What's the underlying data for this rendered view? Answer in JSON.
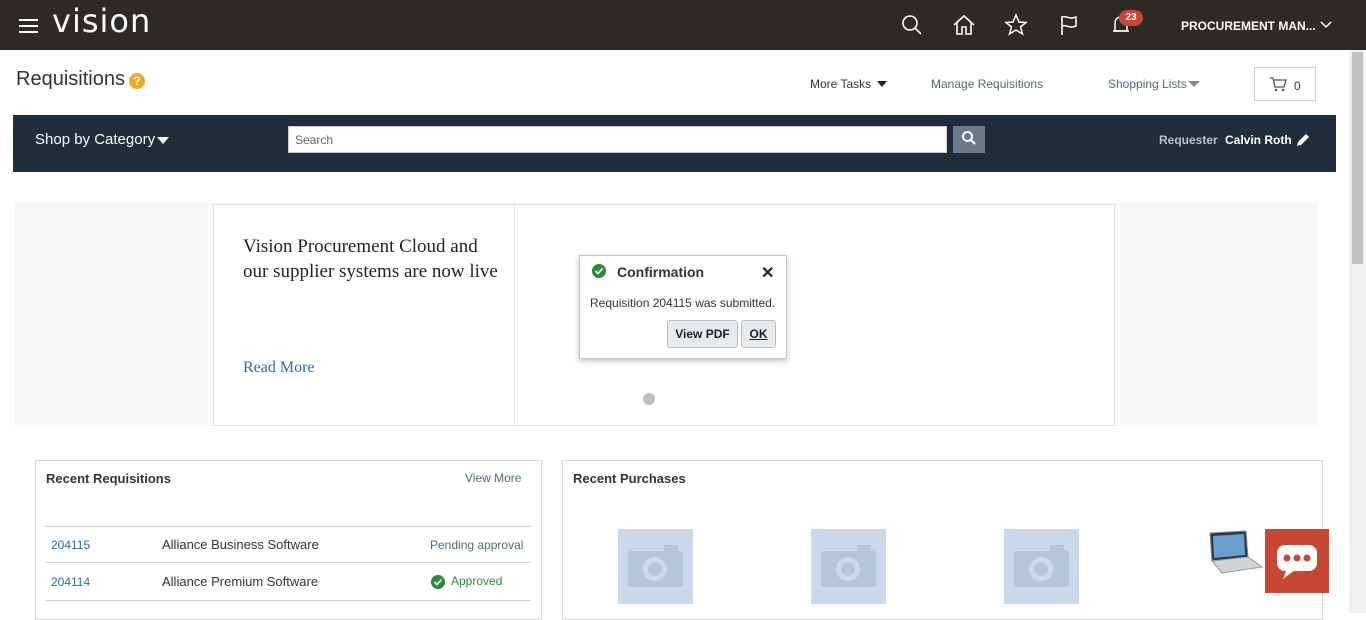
{
  "header": {
    "logo": "vision",
    "notification_count": "23",
    "user_menu": "PROCUREMENT MAN..."
  },
  "page": {
    "title": "Requisitions",
    "help": "?",
    "more_tasks": "More Tasks",
    "manage_requisitions": "Manage Requisitions",
    "shopping_lists": "Shopping Lists",
    "cart_count": "0"
  },
  "nav": {
    "shop_by_category": "Shop by Category",
    "search_placeholder": "Search",
    "requester_label": "Requester",
    "requester_name": "Calvin Roth"
  },
  "banner": {
    "headline": "Vision Procurement Cloud and our supplier systems are now live",
    "read_more": "Read More"
  },
  "dialog": {
    "title": "Confirmation",
    "close": "✕",
    "message": "Requisition 204115 was submitted.",
    "view_pdf": "View PDF",
    "ok": "OK"
  },
  "recent_requisitions": {
    "title": "Recent Requisitions",
    "view_more": "View More",
    "rows": [
      {
        "id": "204115",
        "name": "Alliance Business Software",
        "status": "Pending approval"
      },
      {
        "id": "204114",
        "name": "Alliance Premium Software",
        "status": "Approved"
      }
    ]
  },
  "recent_purchases": {
    "title": "Recent Purchases"
  },
  "colors": {
    "topbar": "#2e2a27",
    "navbar": "#1f2d3d",
    "accent_red": "#c74634",
    "success_green": "#2e8b3a"
  }
}
